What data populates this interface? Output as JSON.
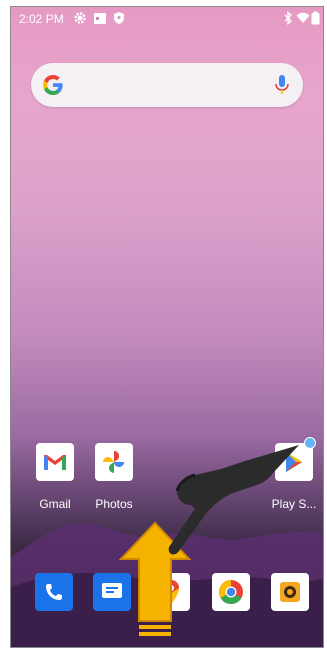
{
  "status_bar": {
    "time": "2:02 PM",
    "left_icons": [
      "gear-icon",
      "calendar-icon",
      "shield-icon"
    ],
    "right_icons": [
      "bluetooth-icon",
      "wifi-icon",
      "battery-icon"
    ]
  },
  "search_bar": {
    "logo": "google-g-icon",
    "voice": "mic-icon"
  },
  "home_apps": [
    {
      "label": "Gmail",
      "icon": "gmail-icon"
    },
    {
      "label": "Photos",
      "icon": "photos-icon"
    },
    {
      "label": "Play S...",
      "icon": "play-store-icon"
    }
  ],
  "dock": [
    "phone-icon",
    "messages-icon",
    "maps-icon",
    "chrome-icon",
    "camera-icon"
  ],
  "overlay": {
    "gesture": "swipe-up-arrow",
    "pointer": "pointing-hand"
  },
  "colors": {
    "arrow": "#f5b300",
    "hand": "#2b2b2b",
    "dock_blue": "#1a73e8",
    "camera_orange": "#f5a623",
    "badge": "#64b5f6"
  }
}
